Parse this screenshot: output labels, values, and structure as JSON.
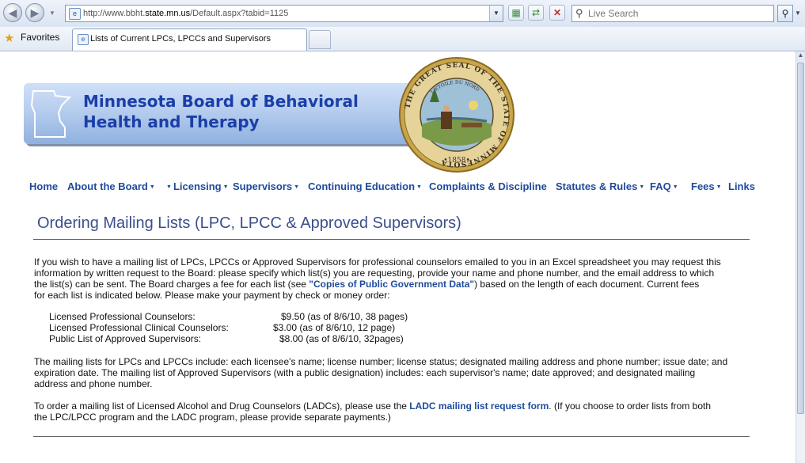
{
  "browser": {
    "url_prefix": "http://www.bbht.",
    "url_domain": "state.mn.us",
    "url_suffix": "/Default.aspx?tabid=1125",
    "search_placeholder": "Live Search",
    "favorites_label": "Favorites",
    "tab_title": "Lists of Current LPCs, LPCCs and Supervisors"
  },
  "banner": {
    "title_line1": "Minnesota Board of Behavioral",
    "title_line2": "Health and Therapy",
    "seal_text": "THE GREAT SEAL OF THE STATE OF MINNESOTA",
    "seal_motto": "L'ETOILE DU NORD",
    "seal_year": "1858"
  },
  "menu": [
    {
      "label": "Home"
    },
    {
      "label": "About the Board"
    },
    {
      "label": "Licensing"
    },
    {
      "label": "Supervisors"
    },
    {
      "label": "Continuing Education"
    },
    {
      "label": "Complaints & Discipline"
    },
    {
      "label": "Statutes & Rules"
    },
    {
      "label": "FAQ"
    },
    {
      "label": "Fees"
    },
    {
      "label": "Links"
    }
  ],
  "page": {
    "heading": "Ordering Mailing Lists (LPC, LPCC & Approved Supervisors)",
    "p1_lines": [
      "If you wish to have a mailing list of LPCs, LPCCs or Approved Supervisors for professional counselors emailed to you in an Excel spreadsheet you may request this",
      "information by written request to the Board: please specify which list(s) you are requesting, provide your name and phone number, and the email address to which",
      "the list(s) can be sent.  The Board charges a fee for each list (see ",
      "Copies of Public Government Data",
      ") based on the length of each document.  Current fees",
      "for each list is indicated below.  Please make your payment by check or money order:"
    ],
    "fees": [
      {
        "name": "Licensed Professional Counselors:",
        "price": "$9.50 (as of 8/6/10, 38 pages)"
      },
      {
        "name": "Licensed Professional Clinical Counselors:",
        "price": "$3.00 (as of 8/6/10, 12 page)"
      },
      {
        "name": "Public List of Approved Supervisors:",
        "price": "$8.00 (as of 8/6/10, 32pages)"
      }
    ],
    "p2_lines": [
      "The mailing lists for LPCs and LPCCs include: each licensee's name; license number; license status; designated mailing address and phone number; issue date; and",
      "expiration date.  The mailing list of Approved Supervisors (with a public designation) includes: each supervisor's name; date approved; and designated mailing",
      "address and phone number."
    ],
    "p3_pre": "To order a mailing list of Licensed Alcohol and Drug Counselors (LADCs), please use the ",
    "p3_link": "LADC mailing list request form",
    "p3_post": ".  (If you choose to order lists from both",
    "p3_line2": "the LPC/LPCC program and the LADC program, please provide separate payments.)"
  }
}
